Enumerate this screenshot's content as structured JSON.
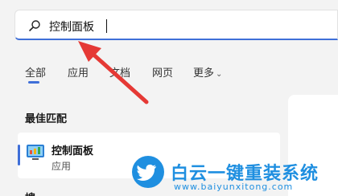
{
  "search": {
    "query": "控制面板"
  },
  "tabs": [
    {
      "label": "全部",
      "active": true
    },
    {
      "label": "应用",
      "active": false
    },
    {
      "label": "文档",
      "active": false
    },
    {
      "label": "网页",
      "active": false
    },
    {
      "label": "更多",
      "active": false,
      "has_dropdown": true
    }
  ],
  "results": {
    "section_title": "最佳匹配",
    "best_match": {
      "name": "控制面板",
      "type": "应用",
      "icon": "control-panel-icon"
    }
  },
  "next_section_title": "搜",
  "watermark": {
    "title": "白云一键重装系统",
    "url": "www.baiyunxitong.com",
    "icon": "twitter-bird-icon"
  },
  "colors": {
    "accent": "#3f6fd8",
    "arrow": "#e53935",
    "watermark": "#1f8fe0",
    "background": "#f3f3f3"
  }
}
